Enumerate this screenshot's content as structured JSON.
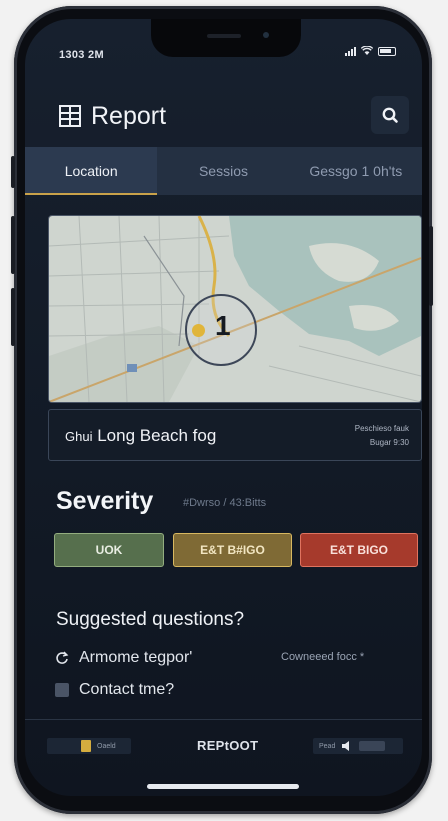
{
  "status_bar": {
    "time": "1303 2M"
  },
  "app": {
    "title": "Report"
  },
  "tabs": [
    {
      "label": "Location",
      "active": true
    },
    {
      "label": "Sessios",
      "active": false
    },
    {
      "label": "Gessgo 1 0h'ts",
      "active": false
    }
  ],
  "map": {
    "marker_label": "1"
  },
  "location_card": {
    "place": "Long Beach fog",
    "place_prefix": "Ghui",
    "meta_line1": "Peschieso fauk",
    "meta_line2": "Bugar 9:30"
  },
  "severity": {
    "title": "Severity",
    "note": "#Dwrso / 43:Bitts",
    "buttons": [
      {
        "label": "UOK",
        "color": "#566f4d"
      },
      {
        "label": "E&T B#IGO",
        "color": "#7f6a35"
      },
      {
        "label": "E&T BIGO",
        "color": "#a63a2c"
      }
    ]
  },
  "questions": {
    "title": "Suggested questions?",
    "items": [
      {
        "text": "Armome tegpor'",
        "hint": "Cowneeed focc *"
      },
      {
        "text": "Contact tme?"
      }
    ]
  },
  "bottom_bar": {
    "left_text": "Oaeld",
    "center_label": "REPtOOT",
    "right_text": "Pead"
  },
  "colors": {
    "accent": "#c9a24a",
    "background": "#131b27",
    "tab_bar": "#243042"
  }
}
